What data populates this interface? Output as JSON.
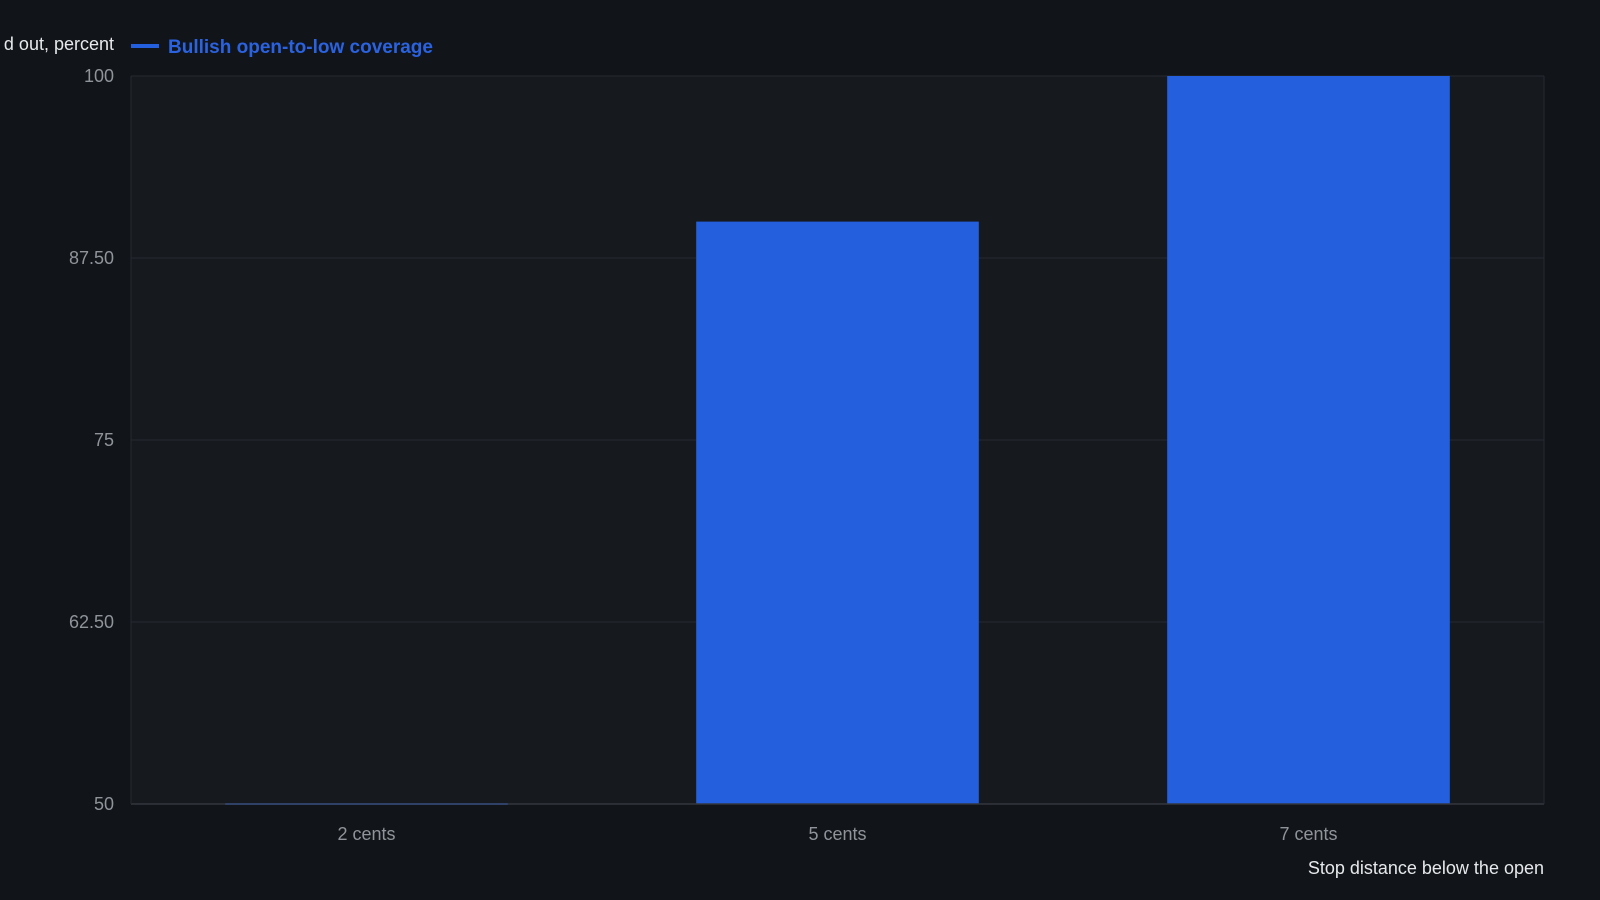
{
  "chart_data": {
    "type": "bar",
    "categories": [
      "2 cents",
      "5 cents",
      "7 cents"
    ],
    "series": [
      {
        "name": "Bullish open-to-low coverage",
        "values": [
          50,
          90,
          100
        ]
      }
    ],
    "xlabel": "Stop distance below the open",
    "ylabel": "d out, percent",
    "ylim": [
      50,
      100
    ],
    "yticks": [
      "50",
      "62.50",
      "75",
      "87.50",
      "100"
    ],
    "grid": true,
    "legend": "top-left"
  },
  "colors": {
    "background": "#111418",
    "plot_background": "#16191e",
    "bar": "#2460de",
    "grid": "#262a31",
    "axis": "#33373e",
    "tick_text": "#8f949b",
    "title_text": "#e6e8eb"
  }
}
